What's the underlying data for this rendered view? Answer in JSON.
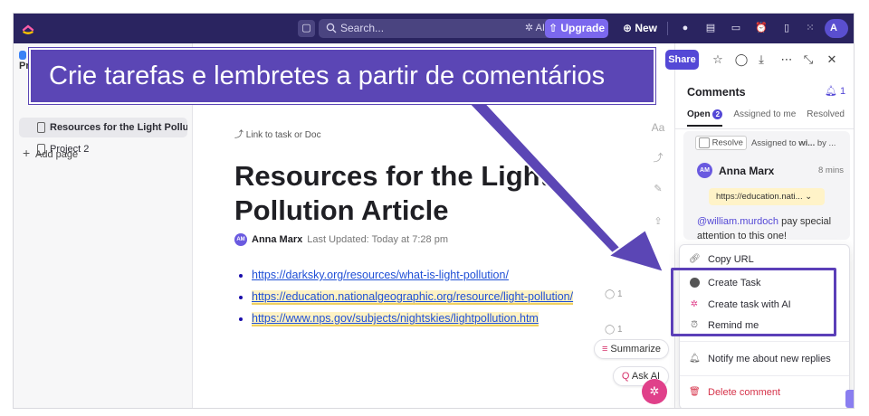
{
  "topbar": {
    "search_placeholder": "Search...",
    "search_ai": "AI",
    "upgrade_label": "Upgrade",
    "new_label": "New",
    "avatar_initial": "A"
  },
  "sidebar": {
    "header": "Pr",
    "items": [
      {
        "label": "Resources for the Light Polluti...",
        "active": true
      },
      {
        "label": "Project 2",
        "active": false
      }
    ],
    "add_page": "Add page"
  },
  "doc": {
    "link_task": "Link to task or Doc",
    "title": "Resources for the Light Pollution Article",
    "author_initials": "AM",
    "author": "Anna Marx",
    "last_updated": "Last Updated: Today at 7:28 pm",
    "links": [
      "https://darksky.org/resources/what-is-light-pollution/",
      "https://education.nationalgeographic.org/resource/light-pollution/",
      "https://www.nps.gov/subjects/nightskies/lightpollution.htm"
    ],
    "comment_counts": [
      "1",
      "1"
    ],
    "summarize_label": "Summarize",
    "ask_ai_label": "Ask AI",
    "font_tool": "Aa"
  },
  "comments": {
    "share_label": "Share",
    "title": "Comments",
    "count": "1",
    "tabs": [
      {
        "label": "Open",
        "badge": "2"
      },
      {
        "label": "Assigned to me"
      },
      {
        "label": "Resolved"
      }
    ],
    "card": {
      "resolve_label": "Resolve",
      "assigned_prefix": "Assigned to",
      "assigned_user": "wi...",
      "assigned_by": "by ...",
      "author_initials": "AM",
      "author": "Anna Marx",
      "time": "8 mins",
      "url_chip": "https://education.nati...",
      "mention": "@william.murdoch",
      "text": " pay special attention to this one!"
    }
  },
  "menu": {
    "items": [
      {
        "label": "Copy URL",
        "icon": "link-icon"
      },
      {
        "label": "Create Task",
        "icon": "task-icon"
      },
      {
        "label": "Create task with AI",
        "icon": "ai-icon"
      },
      {
        "label": "Remind me",
        "icon": "alarm-icon"
      },
      {
        "label": "Notify me about new replies",
        "icon": "bell-icon"
      },
      {
        "label": "Delete comment",
        "icon": "trash-icon"
      }
    ]
  },
  "banner": {
    "text": "Crie tarefas e lembretes a partir de comentários"
  },
  "colors": {
    "topbar": "#2a2460",
    "accent": "#5448d6",
    "banner": "#5b46b5",
    "danger": "#d6334a"
  }
}
